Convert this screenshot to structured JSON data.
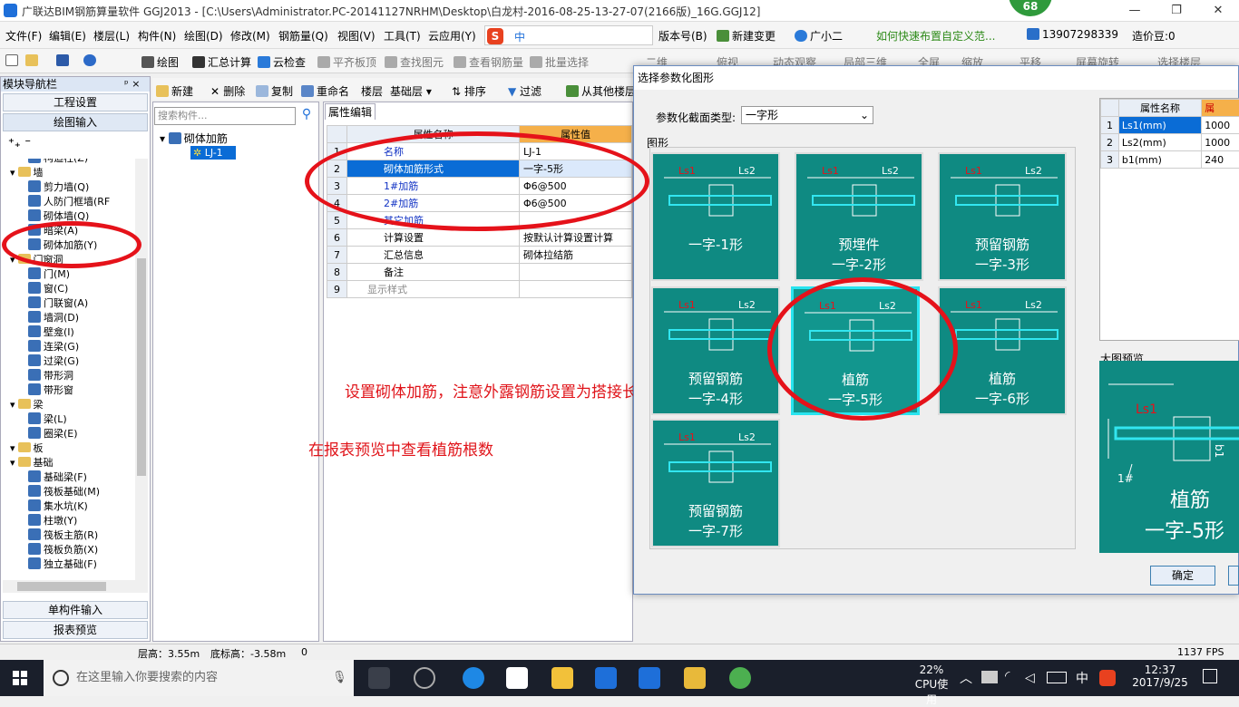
{
  "window": {
    "title": "广联达BIM钢筋算量软件 GGJ2013 - [C:\\Users\\Administrator.PC-20141127NRHM\\Desktop\\白龙村-2016-08-25-13-27-07(2166版)_16G.GGJ12]",
    "badge": "68",
    "min": "—",
    "max": "❐",
    "close": "✕"
  },
  "menu": {
    "items": [
      "文件(F)",
      "编辑(E)",
      "楼层(L)",
      "构件(N)",
      "绘图(D)",
      "修改(M)",
      "钢筋量(Q)",
      "视图(V)",
      "工具(T)",
      "云应用(Y)"
    ],
    "version": "版本号(B)",
    "new_change": "新建变更",
    "guang": "广小二",
    "tip": "如何快速布置自定义范...",
    "phone": "13907298339",
    "beans": "造价豆:0"
  },
  "toolbar": {
    "draw": "绘图",
    "sum": "汇总计算",
    "cloud_check": "云检查",
    "flat_top": "平齐板顶",
    "find": "查找图元",
    "view_rebar": "查看钢筋量",
    "batch": "批量选择",
    "view2d": "二维",
    "top_view": "俯视",
    "dynamic": "动态观察",
    "local3d": "局部三维",
    "full": "全屏",
    "zoom": "缩放",
    "pan": "平移",
    "rotate": "屏幕旋转",
    "select_floor": "选择楼层"
  },
  "nav": {
    "title": "模块导航栏",
    "pin": "ᵖ ×",
    "eng_settings": "工程设置",
    "draw_input": "绘图输入",
    "single_input": "单构件输入",
    "report": "报表预览",
    "tree": [
      {
        "label": "构造柱(Z)",
        "level": 2,
        "type": "item"
      },
      {
        "label": "墙",
        "level": 1,
        "type": "folder"
      },
      {
        "label": "剪力墙(Q)",
        "level": 2,
        "type": "item"
      },
      {
        "label": "人防门框墙(RF",
        "level": 2,
        "type": "item"
      },
      {
        "label": "砌体墙(Q)",
        "level": 2,
        "type": "item"
      },
      {
        "label": "暗梁(A)",
        "level": 2,
        "type": "item"
      },
      {
        "label": "砌体加筋(Y)",
        "level": 2,
        "type": "item"
      },
      {
        "label": "门窗洞",
        "level": 1,
        "type": "folder"
      },
      {
        "label": "门(M)",
        "level": 2,
        "type": "item"
      },
      {
        "label": "窗(C)",
        "level": 2,
        "type": "item"
      },
      {
        "label": "门联窗(A)",
        "level": 2,
        "type": "item"
      },
      {
        "label": "墙洞(D)",
        "level": 2,
        "type": "item"
      },
      {
        "label": "壁龛(I)",
        "level": 2,
        "type": "item"
      },
      {
        "label": "连梁(G)",
        "level": 2,
        "type": "item"
      },
      {
        "label": "过梁(G)",
        "level": 2,
        "type": "item"
      },
      {
        "label": "带形洞",
        "level": 2,
        "type": "item"
      },
      {
        "label": "带形窗",
        "level": 2,
        "type": "item"
      },
      {
        "label": "梁",
        "level": 1,
        "type": "folder"
      },
      {
        "label": "梁(L)",
        "level": 2,
        "type": "item"
      },
      {
        "label": "圈梁(E)",
        "level": 2,
        "type": "item"
      },
      {
        "label": "板",
        "level": 1,
        "type": "folder"
      },
      {
        "label": "基础",
        "level": 1,
        "type": "folder"
      },
      {
        "label": "基础梁(F)",
        "level": 2,
        "type": "item"
      },
      {
        "label": "筏板基础(M)",
        "level": 2,
        "type": "item"
      },
      {
        "label": "集水坑(K)",
        "level": 2,
        "type": "item"
      },
      {
        "label": "柱墩(Y)",
        "level": 2,
        "type": "item"
      },
      {
        "label": "筏板主筋(R)",
        "level": 2,
        "type": "item"
      },
      {
        "label": "筏板负筋(X)",
        "level": 2,
        "type": "item"
      },
      {
        "label": "独立基础(F)",
        "level": 2,
        "type": "item"
      }
    ]
  },
  "subtool": {
    "new": "新建",
    "delete": "删除",
    "copy": "复制",
    "rename": "重命名",
    "floor_label": "楼层",
    "floor": "基础层",
    "sort": "排序",
    "filter": "过滤",
    "from_other": "从其他楼层"
  },
  "comp": {
    "search_placeholder": "搜索构件...",
    "root": "砌体加筋",
    "child": "LJ-1"
  },
  "props": {
    "tab": "属性编辑",
    "col_name": "属性名称",
    "col_value": "属性值",
    "rows": [
      {
        "n": "1",
        "name": "名称",
        "value": "LJ-1"
      },
      {
        "n": "2",
        "name": "砌体加筋形式",
        "value": "一字-5形"
      },
      {
        "n": "3",
        "name": "1#加筋",
        "value": "Φ6@500"
      },
      {
        "n": "4",
        "name": "2#加筋",
        "value": "Φ6@500"
      },
      {
        "n": "5",
        "name": "其它加筋",
        "value": ""
      },
      {
        "n": "6",
        "name": "计算设置",
        "value": "按默认计算设置计算"
      },
      {
        "n": "7",
        "name": "汇总信息",
        "value": "砌体拉结筋"
      },
      {
        "n": "8",
        "name": "备注",
        "value": ""
      },
      {
        "n": "9",
        "name": "显示样式",
        "value": ""
      }
    ]
  },
  "annotations": {
    "line1": "设置砌体加筋，注意外露钢筋设置为搭接长度",
    "line2": "在报表预览中查看植筋根数"
  },
  "dialog": {
    "title": "选择参数化图形",
    "type_label": "参数化截面类型:",
    "type_value": "一字形",
    "group": "图形",
    "shapes": [
      {
        "l1": "一字-1形",
        "l2": ""
      },
      {
        "l1": "预埋件",
        "l2": "一字-2形"
      },
      {
        "l1": "预留钢筋",
        "l2": "一字-3形"
      },
      {
        "l1": "预留钢筋",
        "l2": "一字-4形"
      },
      {
        "l1": "植筋",
        "l2": "一字-5形"
      },
      {
        "l1": "植筋",
        "l2": "一字-6形"
      },
      {
        "l1": "预留钢筋",
        "l2": "一字-7形"
      }
    ],
    "param_header": [
      "",
      "属性名称",
      "属"
    ],
    "params": [
      {
        "n": "1",
        "name": "Ls1(mm)",
        "value": "1000"
      },
      {
        "n": "2",
        "name": "Ls2(mm)",
        "value": "1000"
      },
      {
        "n": "3",
        "name": "b1(mm)",
        "value": "240"
      }
    ],
    "preview_label": "大图预览",
    "preview_l1": "植筋",
    "preview_l2": "一字-5形",
    "ok": "确定"
  },
  "status": {
    "floor_height": "层高：3.55m",
    "bottom": "底标高：-3.58m",
    "zero": "0",
    "fps": "1137 FPS"
  },
  "taskbar": {
    "search": "在这里输入你要搜索的内容",
    "cpu": "22%",
    "cpu_label": "CPU使用",
    "ime": "中",
    "time": "12:37",
    "date": "2017/9/25"
  },
  "colors": {
    "tile": "#0f8a82",
    "red": "#e5121a",
    "rebar": "#32e6f0",
    "select": "#0a6cd6"
  }
}
